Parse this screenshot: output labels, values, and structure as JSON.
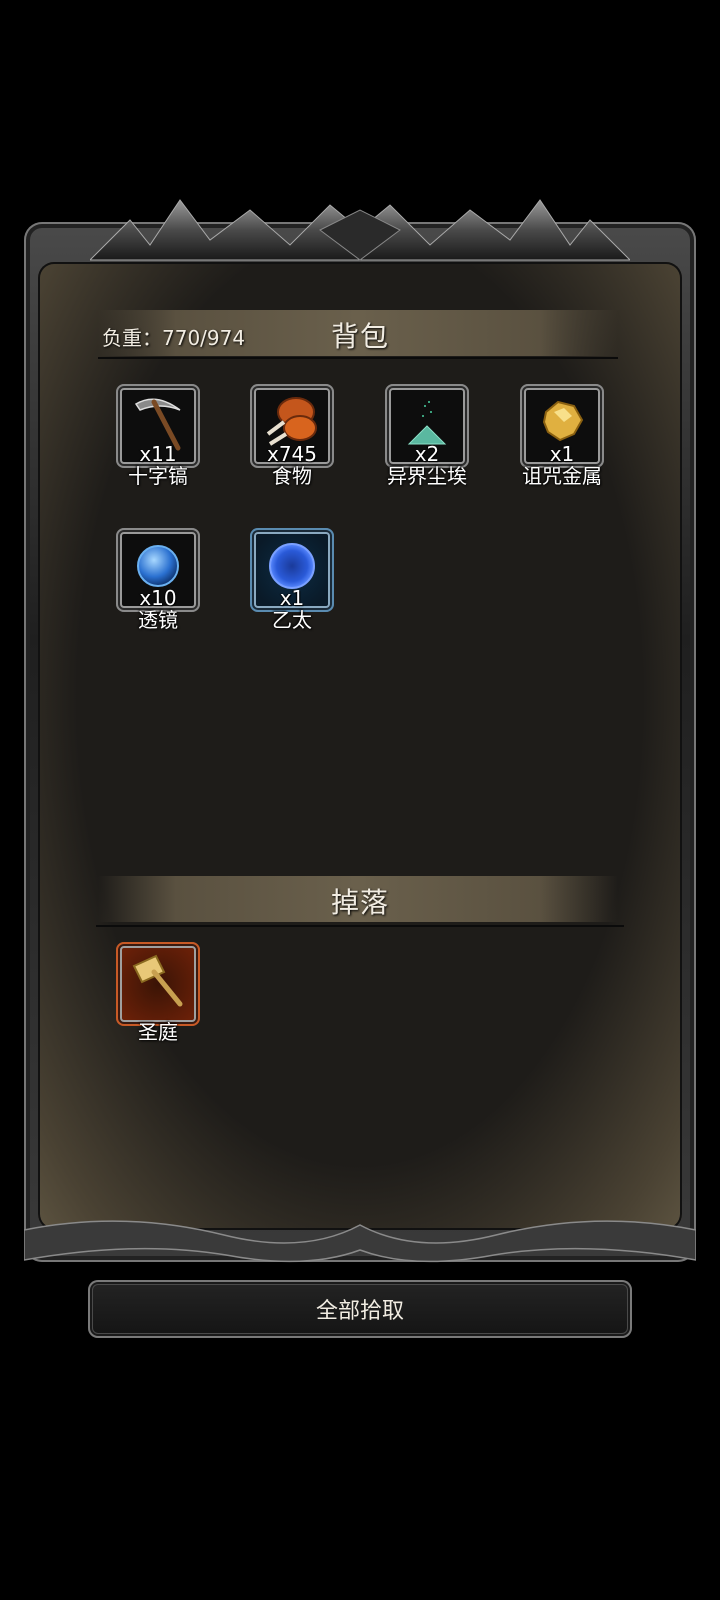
{
  "bag": {
    "title": "背包",
    "weight_label": "负重：770/974",
    "items": [
      {
        "name": "十字镐",
        "count": "x11",
        "icon": "pickaxe-icon"
      },
      {
        "name": "食物",
        "count": "x745",
        "icon": "meat-icon"
      },
      {
        "name": "异界尘埃",
        "count": "x2",
        "icon": "dust-icon"
      },
      {
        "name": "诅咒金属",
        "count": "x1",
        "icon": "gold-ore-icon"
      },
      {
        "name": "透镜",
        "count": "x10",
        "icon": "lens-icon"
      },
      {
        "name": "乙太",
        "count": "x1",
        "icon": "ether-icon"
      }
    ]
  },
  "drop": {
    "title": "掉落",
    "items": [
      {
        "name": "圣庭",
        "icon": "hammer-icon"
      }
    ]
  },
  "actions": {
    "pickup_all": "全部拾取"
  },
  "colors": {
    "panel_bg": "#1e1c19",
    "header_band": "#6a604c",
    "rare_blue": "#5a8bb0",
    "legendary_red": "#c85a26"
  }
}
